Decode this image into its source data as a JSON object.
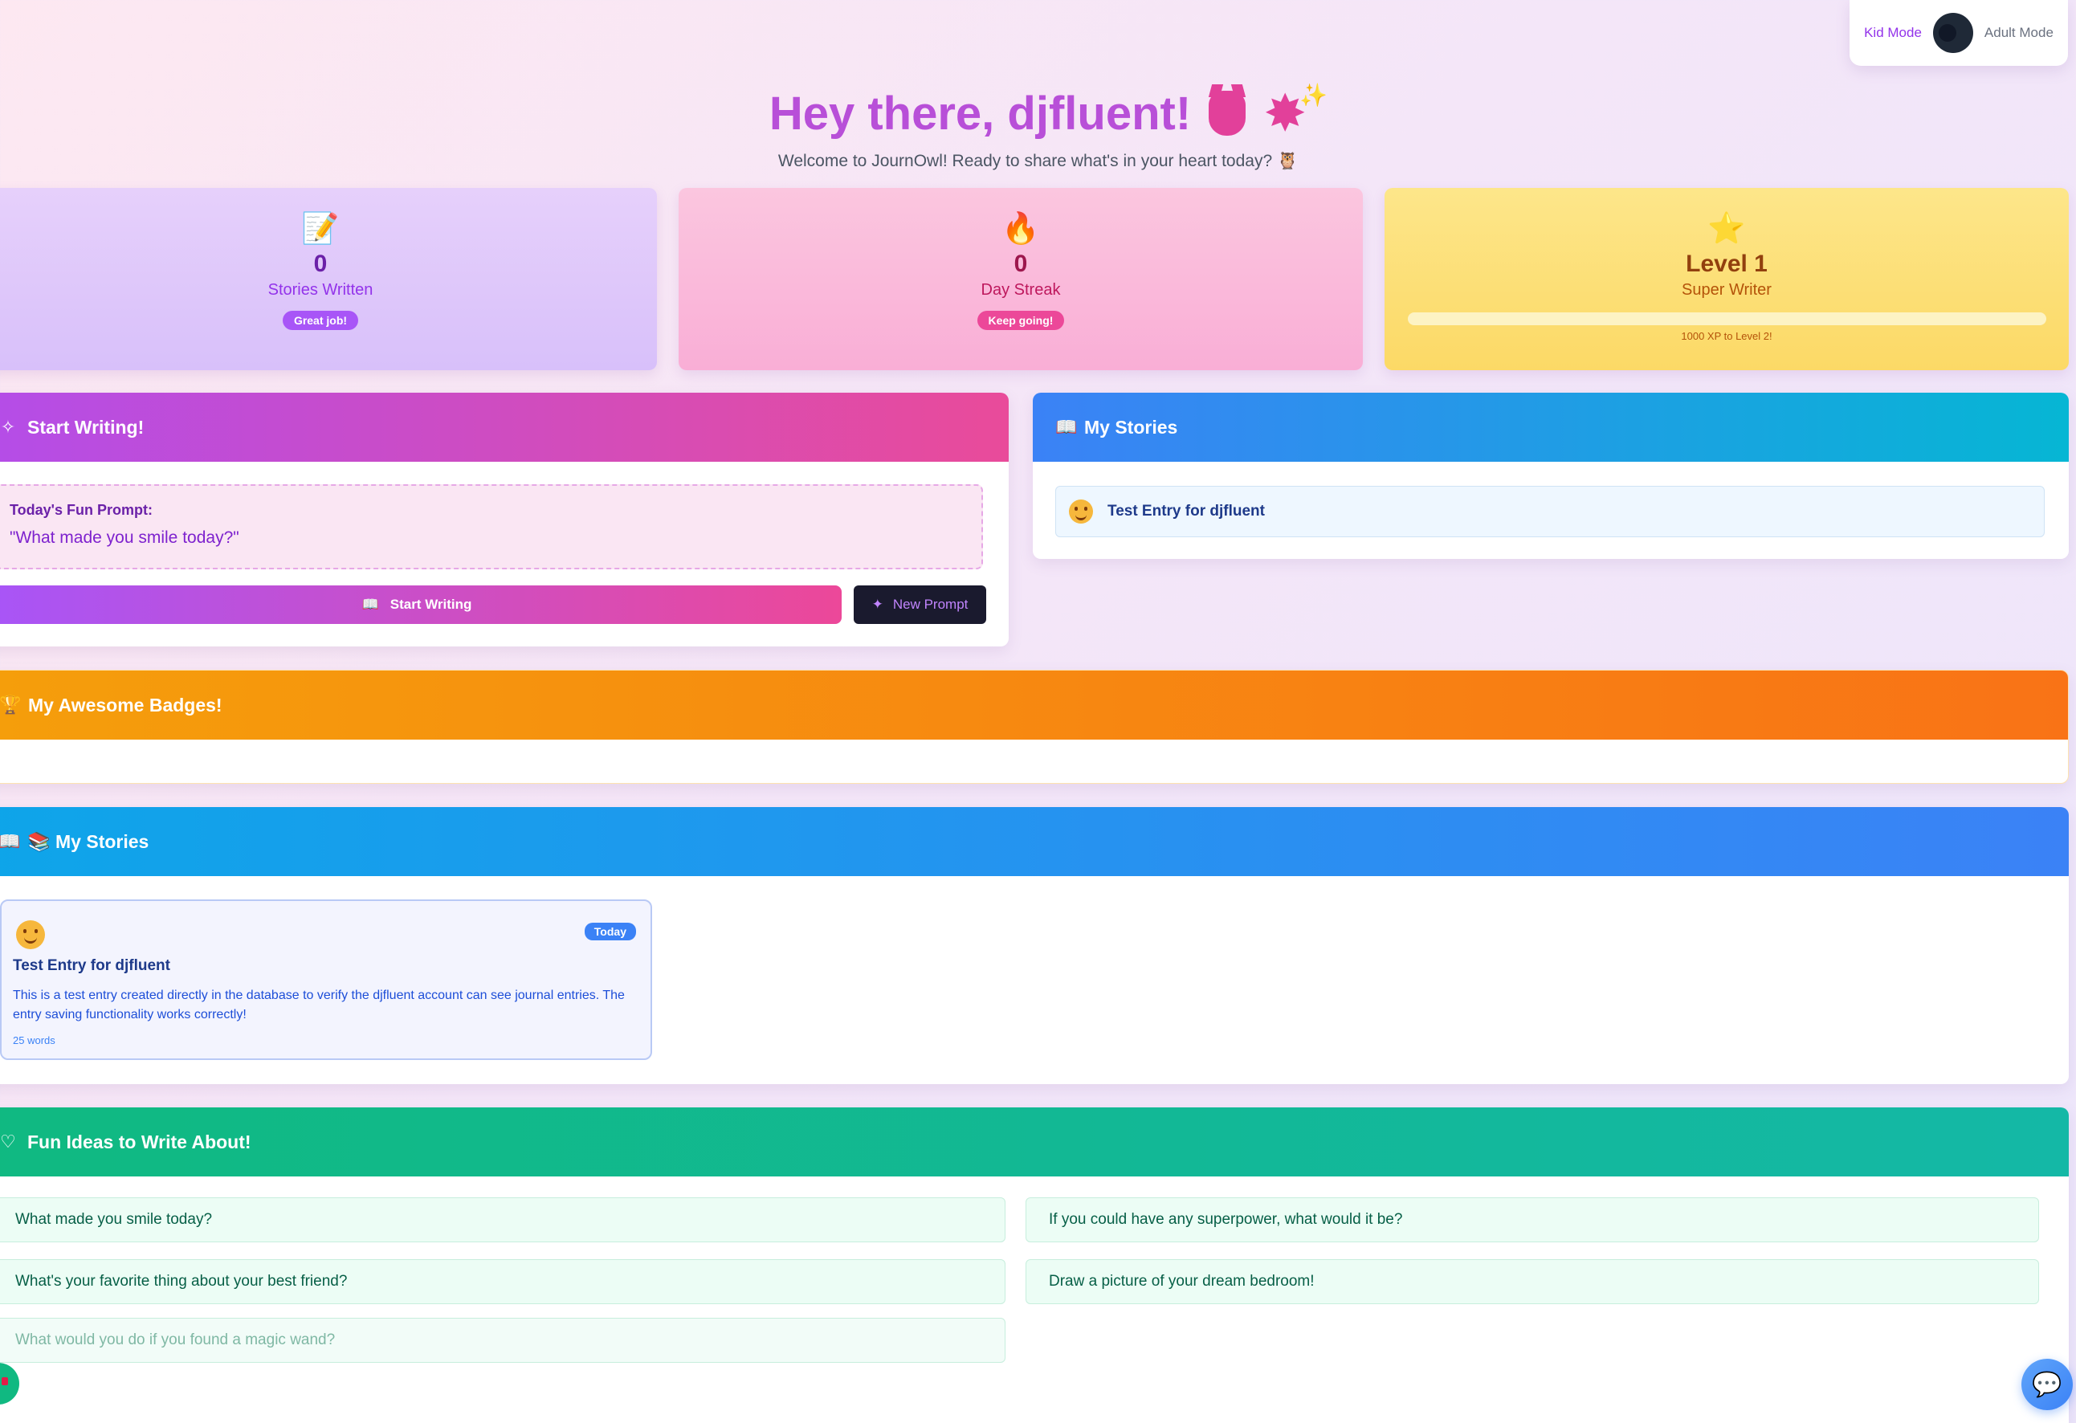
{
  "mode_toggle": {
    "kid_label": "Kid Mode",
    "adult_label": "Adult Mode"
  },
  "hero": {
    "title": "Hey there, djfluent!",
    "subtitle": "Welcome to JournOwl! Ready to share what's in your heart today? 🦉"
  },
  "stats": {
    "stories": {
      "icon": "📝",
      "value": "0",
      "label": "Stories Written",
      "badge": "Great job!"
    },
    "streak": {
      "icon": "🔥",
      "value": "0",
      "label": "Day Streak",
      "badge": "Keep going!"
    },
    "level": {
      "icon": "⭐",
      "value": "Level 1",
      "label": "Super Writer",
      "xp_progress": 0,
      "xp_text": "1000 XP to Level 2!"
    }
  },
  "start_writing": {
    "title": "Start Writing!",
    "prompt_label": "Today's Fun Prompt:",
    "prompt_text": "\"What made you smile today?\"",
    "start_button": "Start Writing",
    "new_prompt_button": "New Prompt"
  },
  "my_stories_side": {
    "title": "My Stories",
    "entries": [
      {
        "title": "Test Entry for djfluent"
      }
    ]
  },
  "badges": {
    "title": "My Awesome Badges!"
  },
  "my_stories_main": {
    "title": "📚 My Stories",
    "card": {
      "badge": "Today",
      "title": "Test Entry for djfluent",
      "body": "This is a test entry created directly in the database to verify the djfluent account can see journal entries. The entry saving functionality works correctly!",
      "words": "25 words"
    }
  },
  "ideas": {
    "title": "Fun Ideas to Write About!",
    "items": [
      "What made you smile today?",
      "If you could have any superpower, what would it be?",
      "What's your favorite thing about your best friend?",
      "Draw a picture of your dream bedroom!",
      "What would you do if you found a magic wand?"
    ]
  },
  "colors": {
    "accent_purple": "#b84fd8",
    "accent_pink": "#ec4899",
    "accent_blue": "#3b82f6",
    "accent_green": "#10b981",
    "accent_orange": "#f59e0b"
  }
}
